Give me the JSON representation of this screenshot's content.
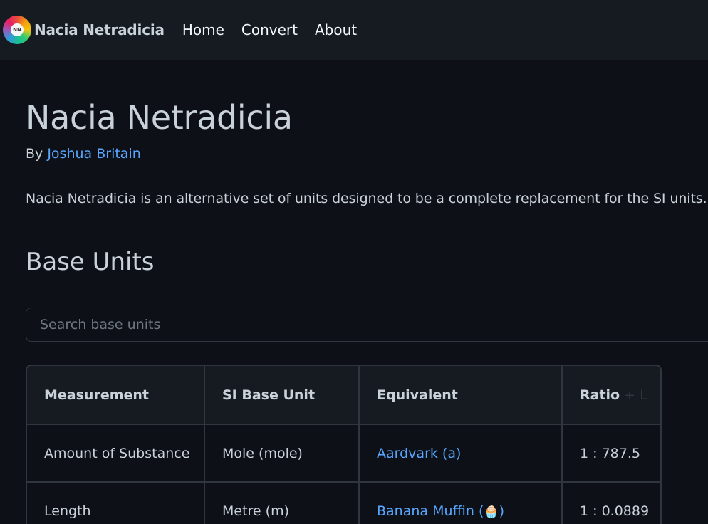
{
  "navbar": {
    "logo_text": "NN",
    "brand": "Nacia Netradicia",
    "links": [
      "Home",
      "Convert",
      "About"
    ]
  },
  "page": {
    "title": "Nacia Netradicia",
    "byline_prefix": "By",
    "author": "Joshua Britain",
    "description": "Nacia Netradicia is an alternative set of units designed to be a complete replacement for the SI units."
  },
  "base_units": {
    "heading": "Base Units",
    "search_placeholder": "Search base units",
    "headers": [
      "Measurement",
      "SI Base Unit",
      "Equivalent",
      "Ratio"
    ],
    "header_hint": "+ L",
    "rows": [
      {
        "measurement": "Amount of Substance",
        "si_unit": "Mole (mole)",
        "equivalent": "Aardvark (a)",
        "equivalent_icon": "",
        "ratio": "1 : 787.5"
      },
      {
        "measurement": "Length",
        "si_unit": "Metre (m)",
        "equivalent": "Banana Muffin (",
        "equivalent_icon": "🧁",
        "equivalent_suffix": ")",
        "ratio": "1 : 0.0889"
      }
    ]
  },
  "colors": {
    "background": "#0d1117",
    "navbar": "#161b22",
    "link": "#58a6ff",
    "border": "#30363d"
  }
}
